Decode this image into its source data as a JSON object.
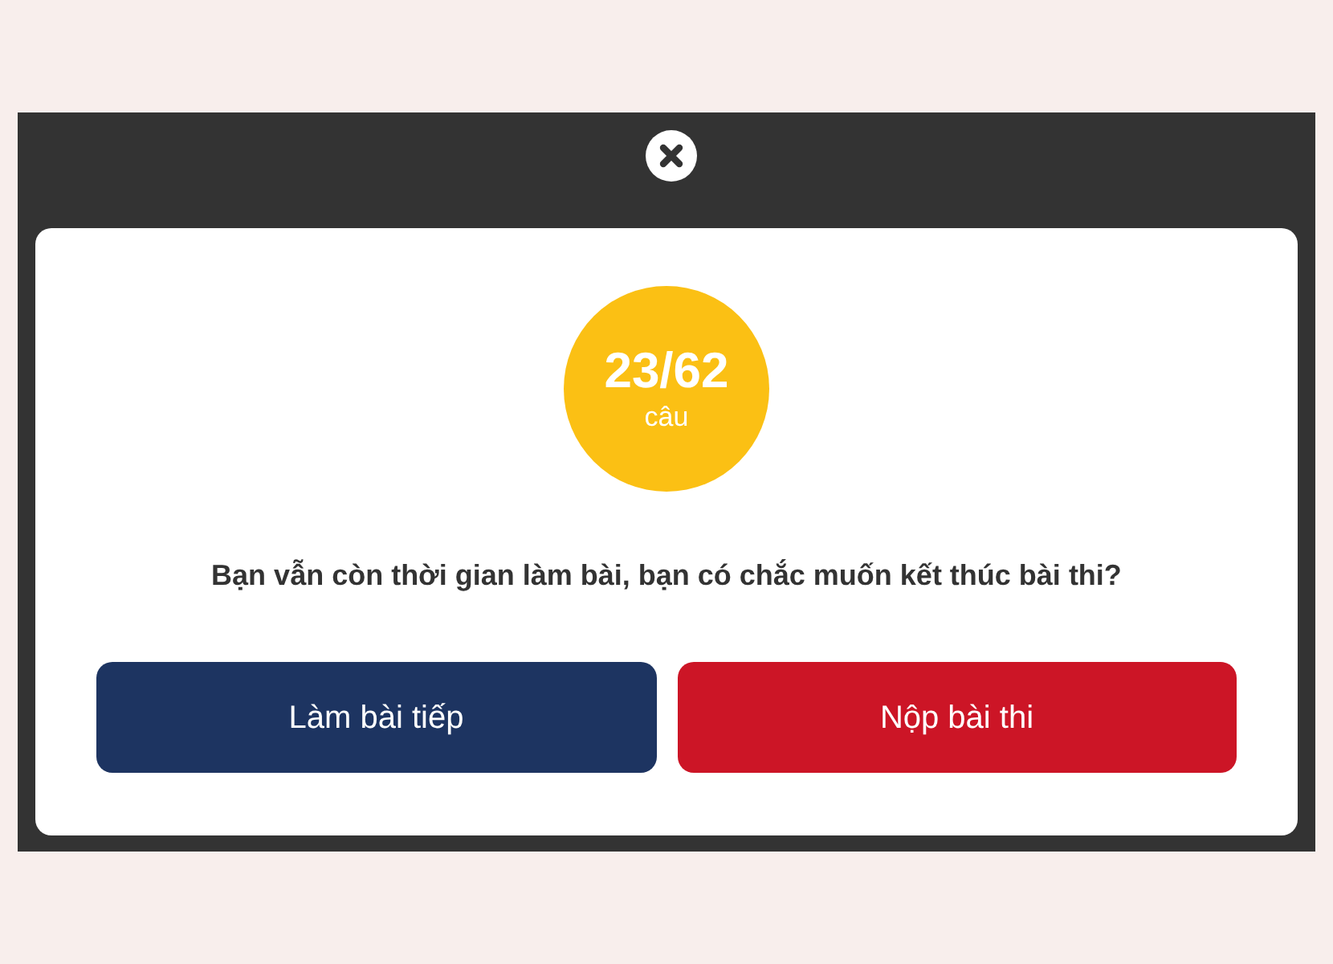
{
  "dialog": {
    "progress": {
      "count": "23/62",
      "unit": "câu"
    },
    "message": "Bạn vẫn còn thời gian làm bài, bạn có chắc muốn kết thúc bài thi?",
    "buttons": [
      {
        "label": "Làm bài tiếp",
        "kind": "secondary"
      },
      {
        "label": "Nộp bài thi",
        "kind": "primary"
      }
    ]
  }
}
